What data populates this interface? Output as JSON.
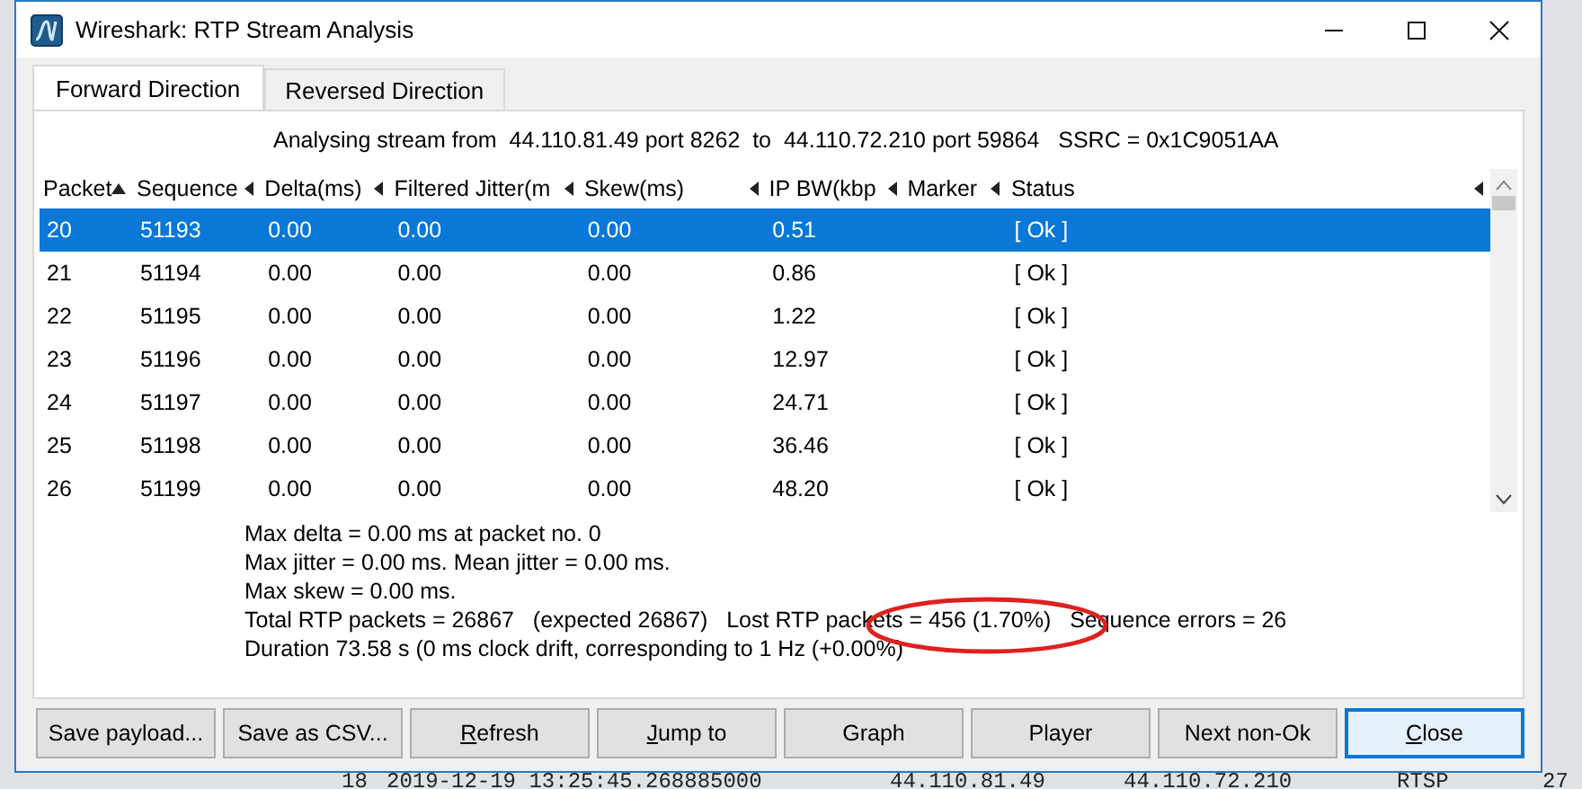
{
  "window": {
    "title": "Wireshark: RTP Stream Analysis"
  },
  "tabs": [
    {
      "label": "Forward Direction",
      "selected": true
    },
    {
      "label": "Reversed Direction",
      "selected": false
    }
  ],
  "stream_info": "Analysing stream from  44.110.81.49 port 8262  to  44.110.72.210 port 59864   SSRC = 0x1C9051AA",
  "table": {
    "columns": [
      {
        "label": "Packet",
        "sorted": true
      },
      {
        "label": "Sequence",
        "sorted": false
      },
      {
        "label": "Delta(ms)",
        "sorted": false
      },
      {
        "label": "Filtered Jitter(m",
        "sorted": false
      },
      {
        "label": "Skew(ms)",
        "sorted": false
      },
      {
        "label": "IP BW(kbp",
        "sorted": false
      },
      {
        "label": "Marker",
        "sorted": false
      },
      {
        "label": "Status",
        "sorted": false
      }
    ],
    "rows": [
      {
        "selected": true,
        "cells": [
          "20",
          "51193",
          "0.00",
          "0.00",
          "0.00",
          "0.51",
          "",
          "[ Ok ]"
        ]
      },
      {
        "selected": false,
        "cells": [
          "21",
          "51194",
          "0.00",
          "0.00",
          "0.00",
          "0.86",
          "",
          "[ Ok ]"
        ]
      },
      {
        "selected": false,
        "cells": [
          "22",
          "51195",
          "0.00",
          "0.00",
          "0.00",
          "1.22",
          "",
          "[ Ok ]"
        ]
      },
      {
        "selected": false,
        "cells": [
          "23",
          "51196",
          "0.00",
          "0.00",
          "0.00",
          "12.97",
          "",
          "[ Ok ]"
        ]
      },
      {
        "selected": false,
        "cells": [
          "24",
          "51197",
          "0.00",
          "0.00",
          "0.00",
          "24.71",
          "",
          "[ Ok ]"
        ]
      },
      {
        "selected": false,
        "cells": [
          "25",
          "51198",
          "0.00",
          "0.00",
          "0.00",
          "36.46",
          "",
          "[ Ok ]"
        ]
      },
      {
        "selected": false,
        "cells": [
          "26",
          "51199",
          "0.00",
          "0.00",
          "0.00",
          "48.20",
          "",
          "[ Ok ]"
        ]
      }
    ]
  },
  "summary": [
    "Max delta = 0.00 ms at packet no. 0",
    "Max jitter = 0.00 ms. Mean jitter = 0.00 ms.",
    "Max skew = 0.00 ms.",
    "Total RTP packets = 26867   (expected 26867)   Lost RTP packets = 456 (1.70%)   Sequence errors = 26",
    "Duration 73.58 s (0 ms clock drift, corresponding to 1 Hz (+0.00%)"
  ],
  "buttons": [
    {
      "label": "Save payload...",
      "default": false
    },
    {
      "label": "Save as CSV...",
      "default": false
    },
    {
      "mnemonic": "R",
      "rest": "efresh",
      "default": false
    },
    {
      "mnemonic": "J",
      "rest": "ump to",
      "default": false
    },
    {
      "label": "Graph",
      "default": false
    },
    {
      "label": "Player",
      "default": false
    },
    {
      "label": "Next non-Ok",
      "default": false
    },
    {
      "mnemonic": "C",
      "rest": "lose",
      "default": true
    }
  ],
  "background_row": [
    "18",
    "2019-12-19 13:25:45.268885000",
    "44.110.81.49",
    "44.110.72.210",
    "RTSP",
    "27"
  ]
}
